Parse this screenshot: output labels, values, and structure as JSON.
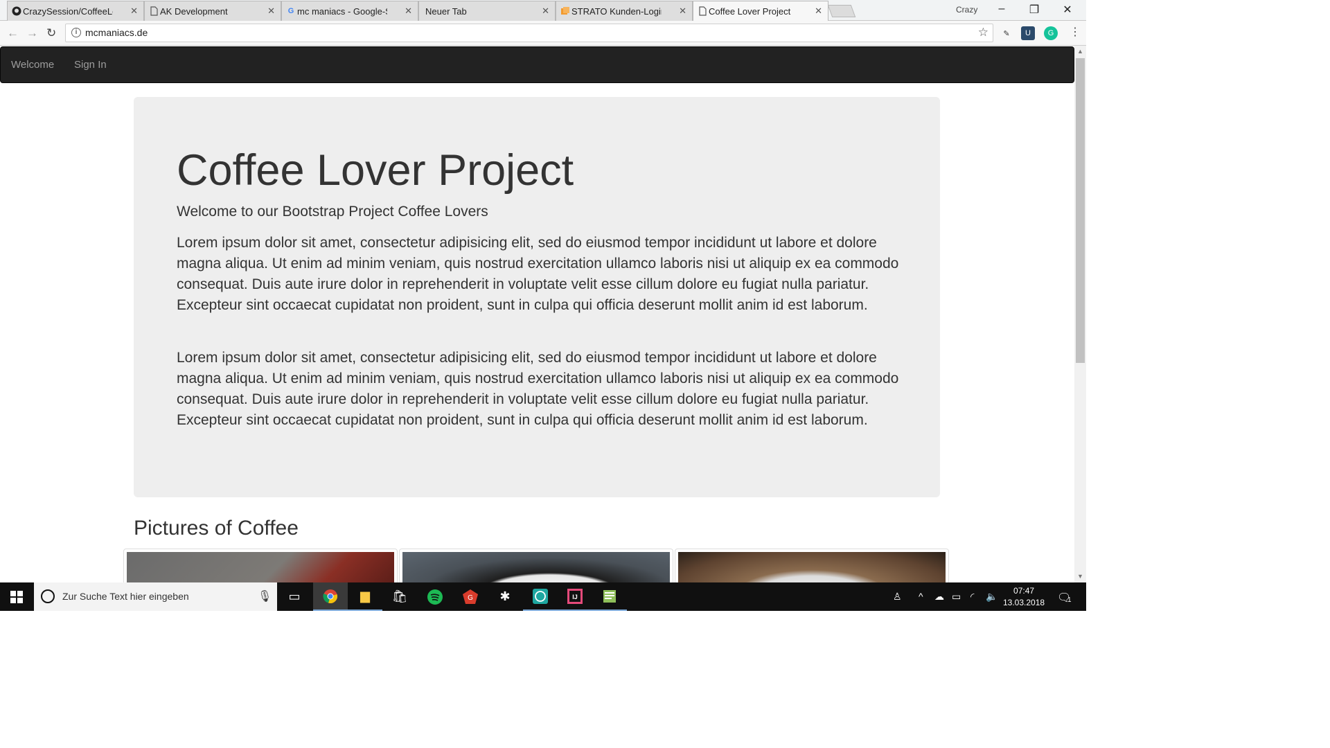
{
  "browser": {
    "tabs": [
      {
        "label": "CrazySession/CoffeeLove",
        "favicon": "github-icon",
        "active": false
      },
      {
        "label": "AK Development",
        "favicon": "page-icon",
        "active": false
      },
      {
        "label": "mc maniacs - Google-Su",
        "favicon": "google-icon",
        "active": false
      },
      {
        "label": "Neuer Tab",
        "favicon": "none",
        "active": false
      },
      {
        "label": "STRATO Kunden-Login",
        "favicon": "strato-icon",
        "active": false
      },
      {
        "label": "Coffee Lover Project",
        "favicon": "page-icon",
        "active": true
      }
    ],
    "profile_name": "Crazy",
    "url": "mcmaniacs.de"
  },
  "site": {
    "nav": {
      "welcome": "Welcome",
      "sign_in": "Sign In"
    },
    "jumbotron": {
      "title": "Coffee Lover Project",
      "lead": "Welcome to our Bootstrap Project Coffee Lovers",
      "paragraph1": "Lorem ipsum dolor sit amet, consectetur adipisicing elit, sed do eiusmod tempor incididunt ut labore et dolore magna aliqua. Ut enim ad minim veniam, quis nostrud exercitation ullamco laboris nisi ut aliquip ex ea commodo consequat. Duis aute irure dolor in reprehenderit in voluptate velit esse cillum dolore eu fugiat nulla pariatur. Excepteur sint occaecat cupidatat non proident, sunt in culpa qui officia deserunt mollit anim id est laborum.",
      "paragraph2": "Lorem ipsum dolor sit amet, consectetur adipisicing elit, sed do eiusmod tempor incididunt ut labore et dolore magna aliqua. Ut enim ad minim veniam, quis nostrud exercitation ullamco laboris nisi ut aliquip ex ea commodo consequat. Duis aute irure dolor in reprehenderit in voluptate velit esse cillum dolore eu fugiat nulla pariatur. Excepteur sint occaecat cupidatat non proident, sunt in culpa qui officia deserunt mollit anim id est laborum."
    },
    "pictures_heading": "Pictures of Coffee"
  },
  "taskbar": {
    "search_placeholder": "Zur Suche Text hier eingeben",
    "time": "07:47",
    "date": "13.03.2018",
    "notification_count": "1"
  },
  "colors": {
    "navbar_bg": "#222222",
    "jumbotron_bg": "#eeeeee",
    "taskbar_bg": "#101010"
  }
}
